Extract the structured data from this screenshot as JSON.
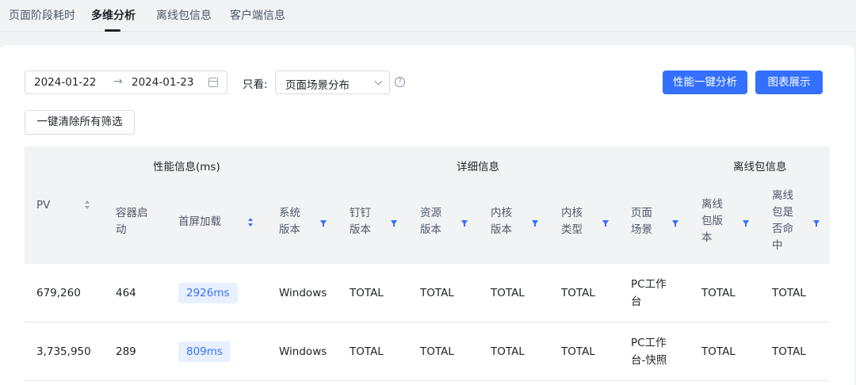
{
  "tabs": [
    {
      "label": "页面阶段耗时",
      "active": false
    },
    {
      "label": "多维分析",
      "active": true
    },
    {
      "label": "离线包信息",
      "active": false
    },
    {
      "label": "客户端信息",
      "active": false
    }
  ],
  "filters": {
    "date_start": "2024-01-22",
    "date_arrow": "→",
    "date_end": "2024-01-23",
    "view_label": "只看:",
    "view_select": "页面场景分布",
    "help": "?",
    "clear_all": "一键清除所有筛选"
  },
  "actions": {
    "analyze": "性能一键分析",
    "chart": "图表展示"
  },
  "table": {
    "groups": {
      "perf": "性能信息(ms)",
      "detail": "详细信息",
      "offline": "离线包信息"
    },
    "columns": {
      "pv": "PV",
      "container": [
        "容器启",
        "动"
      ],
      "first_screen": "首屏加载",
      "sys_version": [
        "系统",
        "版本"
      ],
      "dt_version": [
        "钉钉",
        "版本"
      ],
      "res_version": [
        "资源",
        "版本"
      ],
      "kernel_version": [
        "内核",
        "版本"
      ],
      "kernel_type": [
        "内核",
        "类型"
      ],
      "page_scene": [
        "页面",
        "场景"
      ],
      "offline_version": [
        "离线",
        "包版",
        "本"
      ],
      "offline_hit": [
        "离线",
        "包是",
        "否命",
        "中"
      ]
    },
    "rows": [
      {
        "pv": "679,260",
        "container": "464",
        "first_screen": "2926ms",
        "sys": "Windows",
        "dt": "TOTAL",
        "res": "TOTAL",
        "kver": "TOTAL",
        "ktype": "TOTAL",
        "scene": [
          "PC工作",
          "台"
        ],
        "off_ver": "TOTAL",
        "off_hit": "TOTAL"
      },
      {
        "pv": "3,735,950",
        "container": "289",
        "first_screen": "809ms",
        "sys": "Windows",
        "dt": "TOTAL",
        "res": "TOTAL",
        "kver": "TOTAL",
        "ktype": "TOTAL",
        "scene": [
          "PC工作",
          "台-快照"
        ],
        "off_ver": "TOTAL",
        "off_hit": "TOTAL"
      }
    ]
  },
  "colors": {
    "accent": "#3370ff",
    "header_bg": "#f2f3f5",
    "pill_bg": "#e8f0ff"
  }
}
